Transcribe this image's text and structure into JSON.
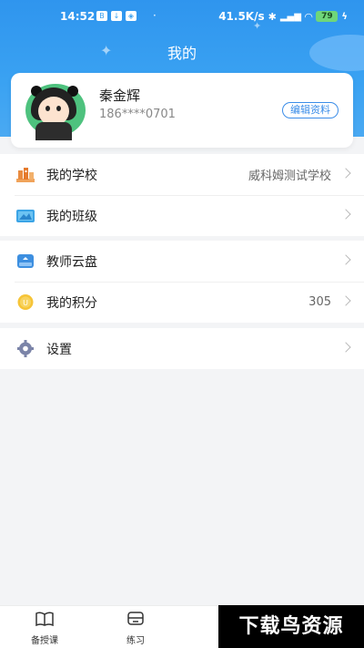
{
  "status_bar": {
    "time": "14:52",
    "network_speed": "41.5K/s",
    "battery": "79"
  },
  "header": {
    "title": "我的"
  },
  "profile": {
    "name": "秦金辉",
    "phone": "186****0701",
    "edit_label": "编辑资料"
  },
  "groups": {
    "school": {
      "label": "我的学校",
      "value": "威科姆测试学校",
      "icon": "school-building-icon"
    },
    "class": {
      "label": "我的班级",
      "icon": "classroom-icon"
    },
    "cloud": {
      "label": "教师云盘",
      "icon": "cloud-disk-icon"
    },
    "points": {
      "label": "我的积分",
      "value": "305",
      "icon": "coin-icon"
    },
    "settings": {
      "label": "设置",
      "icon": "gear-icon"
    }
  },
  "tabbar": {
    "tab1": "备授课",
    "tab2": "练习"
  },
  "watermark": "下载鸟资源",
  "colors": {
    "header_blue": "#2f95ee",
    "accent": "#3b8de8",
    "background": "#f3f4f6"
  }
}
